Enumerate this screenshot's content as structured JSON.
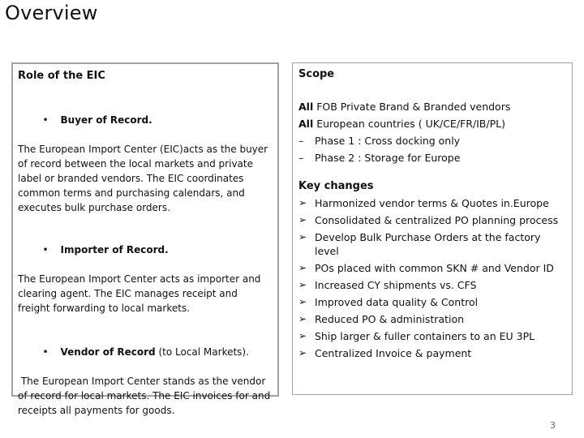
{
  "slide": {
    "title": "Overview",
    "page_number": "3"
  },
  "left_panel": {
    "heading": "Role of the EIC",
    "roles": [
      {
        "bullet": "•",
        "title_bold": "Buyer of Record.",
        "title_normal": "",
        "description": "The European Import Center (EIC)acts as the buyer of record between the local markets and private label or branded vendors.  The EIC coordinates common terms and purchasing calendars, and executes bulk purchase orders."
      },
      {
        "bullet": "•",
        "title_bold": "Importer of Record.",
        "title_normal": "",
        "description": "The European Import Center acts as importer and clearing agent. The EIC manages receipt and freight forwarding to local markets."
      },
      {
        "bullet": "•",
        "title_bold": "Vendor of Record",
        "title_normal": " (to Local Markets).",
        "description": " The European Import Center stands as the vendor of record for local markets. The EIC invoices for and receipts all payments for goods."
      }
    ]
  },
  "right_panel": {
    "scope_heading": "Scope",
    "scope_lines": [
      {
        "lead": "All",
        "text": " FOB Private Brand & Branded vendors"
      },
      {
        "lead": "All",
        "text": " European countries ( UK/CE/FR/IB/PL)"
      }
    ],
    "phases": [
      {
        "dash": "–",
        "text": "Phase 1 : Cross docking only"
      },
      {
        "dash": "–",
        "text": "Phase 2 : Storage for Europe"
      }
    ],
    "key_changes_heading": "Key changes",
    "bullet_icon": "arrowhead-bullet-icon",
    "key_changes": [
      "Harmonized vendor terms & Quotes in.Europe",
      "Consolidated & centralized PO planning process",
      "Develop Bulk Purchase Orders at the factory level",
      "POs placed with common SKN # and Vendor ID",
      "Increased CY shipments vs. CFS",
      "Improved data quality & Control",
      "Reduced PO & administration",
      "Ship larger & fuller containers to an EU 3PL",
      "Centralized Invoice & payment"
    ]
  }
}
